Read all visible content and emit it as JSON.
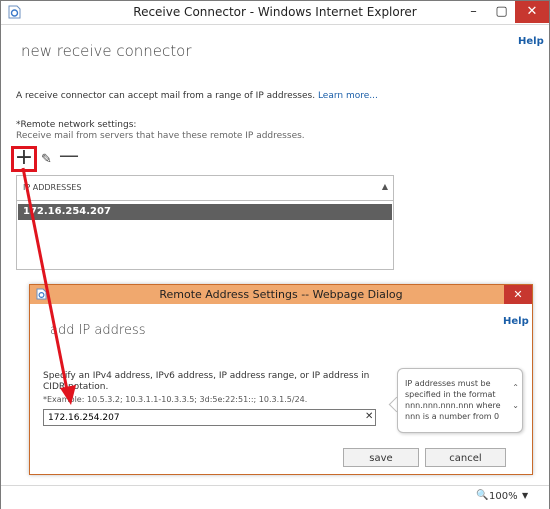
{
  "window": {
    "title": "Receive Connector - Windows Internet Explorer",
    "minimize_glyph": "–",
    "maximize_glyph": "▢",
    "close_glyph": "✕"
  },
  "page": {
    "title": "new receive connector",
    "help": "Help",
    "description": "A receive connector can accept mail from a range of IP addresses.",
    "learn_more": "Learn more...",
    "remote_label": "*Remote network settings:",
    "remote_sub": "Receive mail from servers that have these remote IP addresses."
  },
  "toolbar": {
    "add_glyph": "+",
    "edit_glyph": "✎",
    "remove_glyph": "—"
  },
  "ip_table": {
    "header": "IP ADDRESSES",
    "sort_glyph": "▲",
    "rows": [
      "172.16.254.207"
    ]
  },
  "dialog": {
    "title": "Remote Address Settings -- Webpage Dialog",
    "close_glyph": "✕",
    "heading": "add IP address",
    "help": "Help",
    "spec": "Specify an IPv4 address, IPv6 address, IP address range, or IP address in CIDR notation.",
    "example": "*Example: 10.5.3.2; 10.3.1.1-10.3.3.5; 3d:5e:22:51::; 10.3.1.5/24.",
    "input_value": "172.16.254.207",
    "clear_glyph": "✕",
    "tooltip": "IP addresses must be specified in the format nnn.nnn.nnn.nnn where nnn is a number from 0",
    "tooltip_up": "⌃",
    "tooltip_down": "⌄",
    "save": "save",
    "cancel": "cancel"
  },
  "statusbar": {
    "zoom": "100%",
    "zoom_glyph": "🔍",
    "zoom_arrow": "▼"
  },
  "colors": {
    "annotation": "#e0141e",
    "dialog_titlebar": "#f0a86e",
    "selected_row": "#5f5f5f",
    "link": "#1a5ea8"
  }
}
